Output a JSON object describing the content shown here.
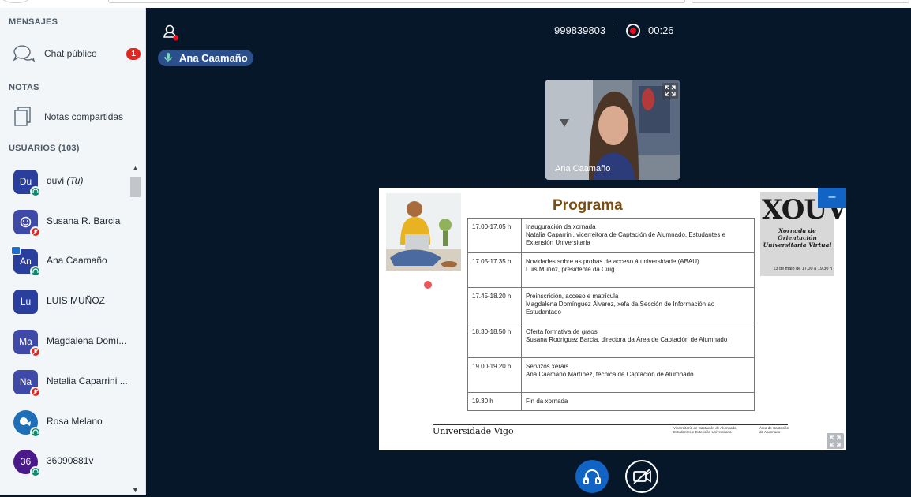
{
  "sidebar": {
    "messages_title": "MENSAJES",
    "public_chat_label": "Chat público",
    "public_chat_badge": "1",
    "notes_title": "NOTAS",
    "shared_notes_label": "Notas compartidas",
    "users_title": "USUARIOS (103)",
    "users": [
      {
        "initials": "Du",
        "name": "duvi",
        "suffix": "(Tu)",
        "color": "#2a3e9e",
        "status": "listen"
      },
      {
        "initials": "",
        "name": "Susana R. Barcia",
        "color": "#3f4aa8",
        "status": "muted"
      },
      {
        "initials": "An",
        "name": "Ana Caamaño",
        "color": "#2a3e9e",
        "status": "listen"
      },
      {
        "initials": "Lu",
        "name": "LUIS MUÑOZ",
        "color": "#2a3e9e",
        "status": "none"
      },
      {
        "initials": "Ma",
        "name": "Magdalena Domí...",
        "color": "#3f4aa8",
        "status": "muted"
      },
      {
        "initials": "Na",
        "name": "Natalia Caparrini ...",
        "color": "#3f4aa8",
        "status": "muted"
      },
      {
        "initials": "",
        "name": "Rosa Melano",
        "color": "#1f6fb8",
        "status": "listen"
      },
      {
        "initials": "36",
        "name": "36090881v",
        "color": "#4b1a8a",
        "status": "listen"
      }
    ]
  },
  "header": {
    "meeting_id": "999839803",
    "timer": "00:26",
    "talking_user": "Ana Caamaño"
  },
  "webcam": {
    "name": "Ana Caamaño"
  },
  "slide": {
    "title": "Programa",
    "rows": [
      {
        "time": "17.00-17.05 h",
        "line1": "Inauguración da xornada",
        "line2": "Natalia Caparrini, vicerreitora de Captación de Alumnado, Estudantes e Extensión Universitaria"
      },
      {
        "time": "17.05-17.35 h",
        "line1": "Novidades sobre as probas de acceso á universidade (ABAU)",
        "line2": "Luis  Muñoz, presidente da Ciug"
      },
      {
        "time": "17.45-18.20 h",
        "line1": "Preinscrición, acceso e matrícula",
        "line2": "Magdalena Domínguez Álvarez, xefa da Sección de Información ao Estudantado"
      },
      {
        "time": "18.30-18.50 h",
        "line1": "Oferta formativa de graos",
        "line2": "Susana Rodríguez Barcia, directora da Área de Captación de Alumnado"
      },
      {
        "time": "19.00-19.20 h",
        "line1": "Servizos xerais",
        "line2": "Ana Caamaño Martínez, técnica de Captación de Alumnado"
      },
      {
        "time": "19.30 h",
        "line1": "Fin da xornada",
        "line2": ""
      }
    ],
    "xo_title": "XOUV",
    "xo_subtitle": "Xornada de Orientación Universitaria Virtual",
    "xo_date": "13 de maio de 17.00 a 19.30 h",
    "footer_logo": "Universidade Vigo",
    "footer_text1": "Vicerreitoría de Captación de Alumnado, Estudantes e Extensión Universitaria",
    "footer_text2": "Área de Captación de Alumnado"
  }
}
